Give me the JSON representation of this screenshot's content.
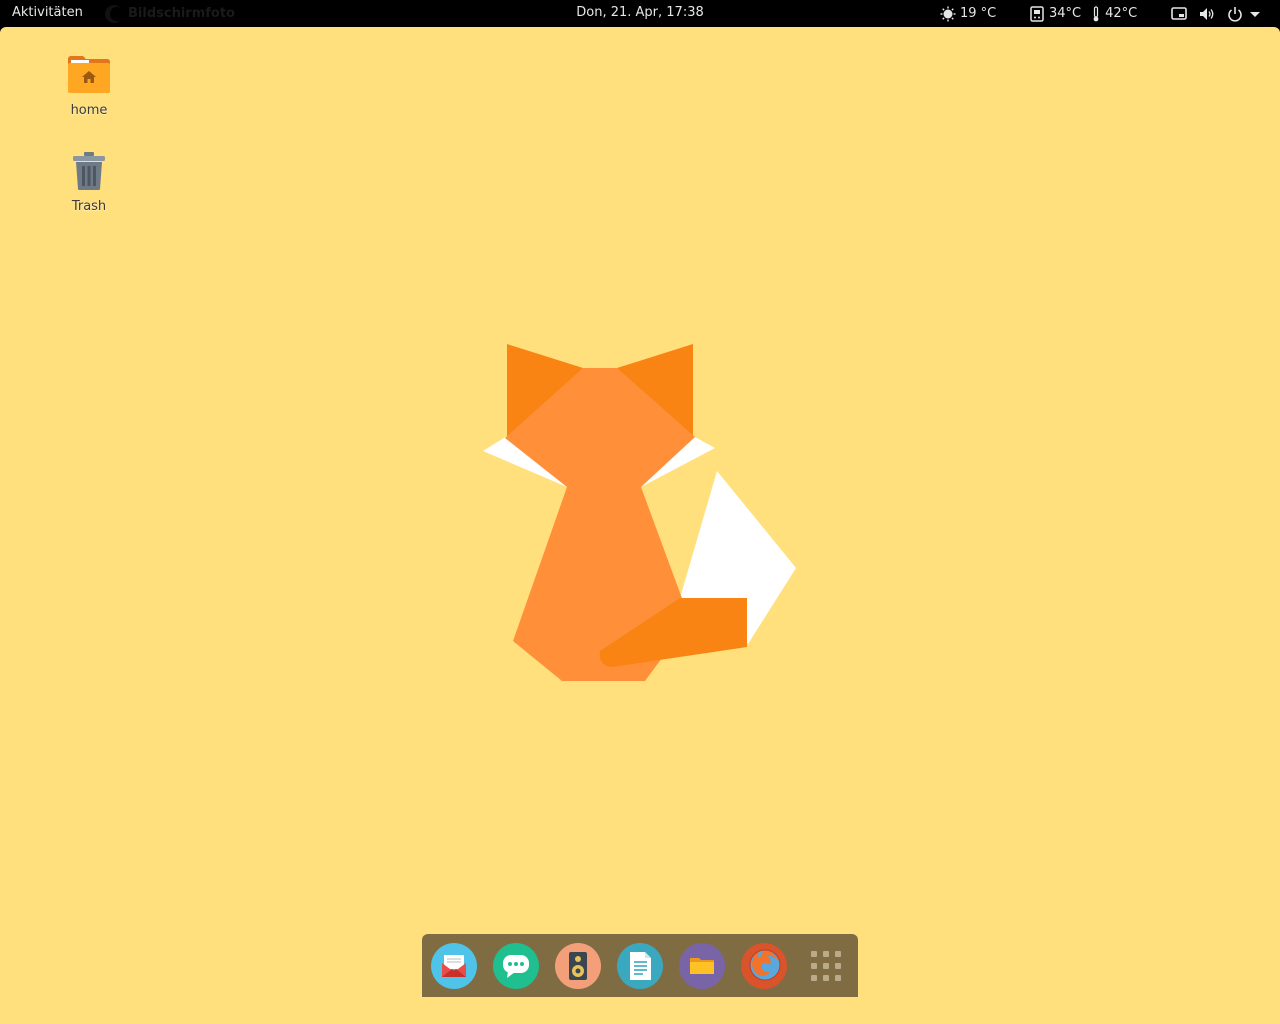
{
  "topbar": {
    "activities": "Aktivitäten",
    "app_menu": "Bildschirmfoto",
    "clock": "Don, 21. Apr, 17:38",
    "weather": {
      "icon": "weather-sun-icon",
      "temperature": "19 °C"
    },
    "sensors": [
      {
        "icon": "cpu-sensor-icon",
        "value": "34°C"
      },
      {
        "icon": "thermometer-icon",
        "value": "42°C"
      }
    ],
    "systray": [
      "screen-icon",
      "volume-icon",
      "power-icon",
      "chevron-down-icon"
    ]
  },
  "desktop": {
    "icons": [
      {
        "name": "home",
        "icon": "home-folder-icon"
      },
      {
        "name": "Trash",
        "icon": "trash-icon"
      }
    ],
    "wallpaper": "fox"
  },
  "dock": {
    "apps": [
      {
        "name": "mail",
        "icon": "mail-icon",
        "color": "#4fc3e8"
      },
      {
        "name": "chat",
        "icon": "chat-icon",
        "color": "#1fbf8f"
      },
      {
        "name": "music",
        "icon": "speaker-icon",
        "color": "#f3a07a"
      },
      {
        "name": "text-editor",
        "icon": "document-icon",
        "color": "#3aa9c0"
      },
      {
        "name": "files",
        "icon": "folder-icon",
        "color": "#7a64a8"
      },
      {
        "name": "firefox",
        "icon": "firefox-icon",
        "color": "#d9532b"
      },
      {
        "name": "show-applications",
        "icon": "grid-icon",
        "color": "#7f6c43"
      }
    ]
  },
  "colors": {
    "desktop_bg": "#ffe07d",
    "topbar_bg": "#000000",
    "fox_orange": "#ff8f38",
    "fox_dark_orange": "#f98313",
    "dock_bg": "#7f6c43"
  }
}
